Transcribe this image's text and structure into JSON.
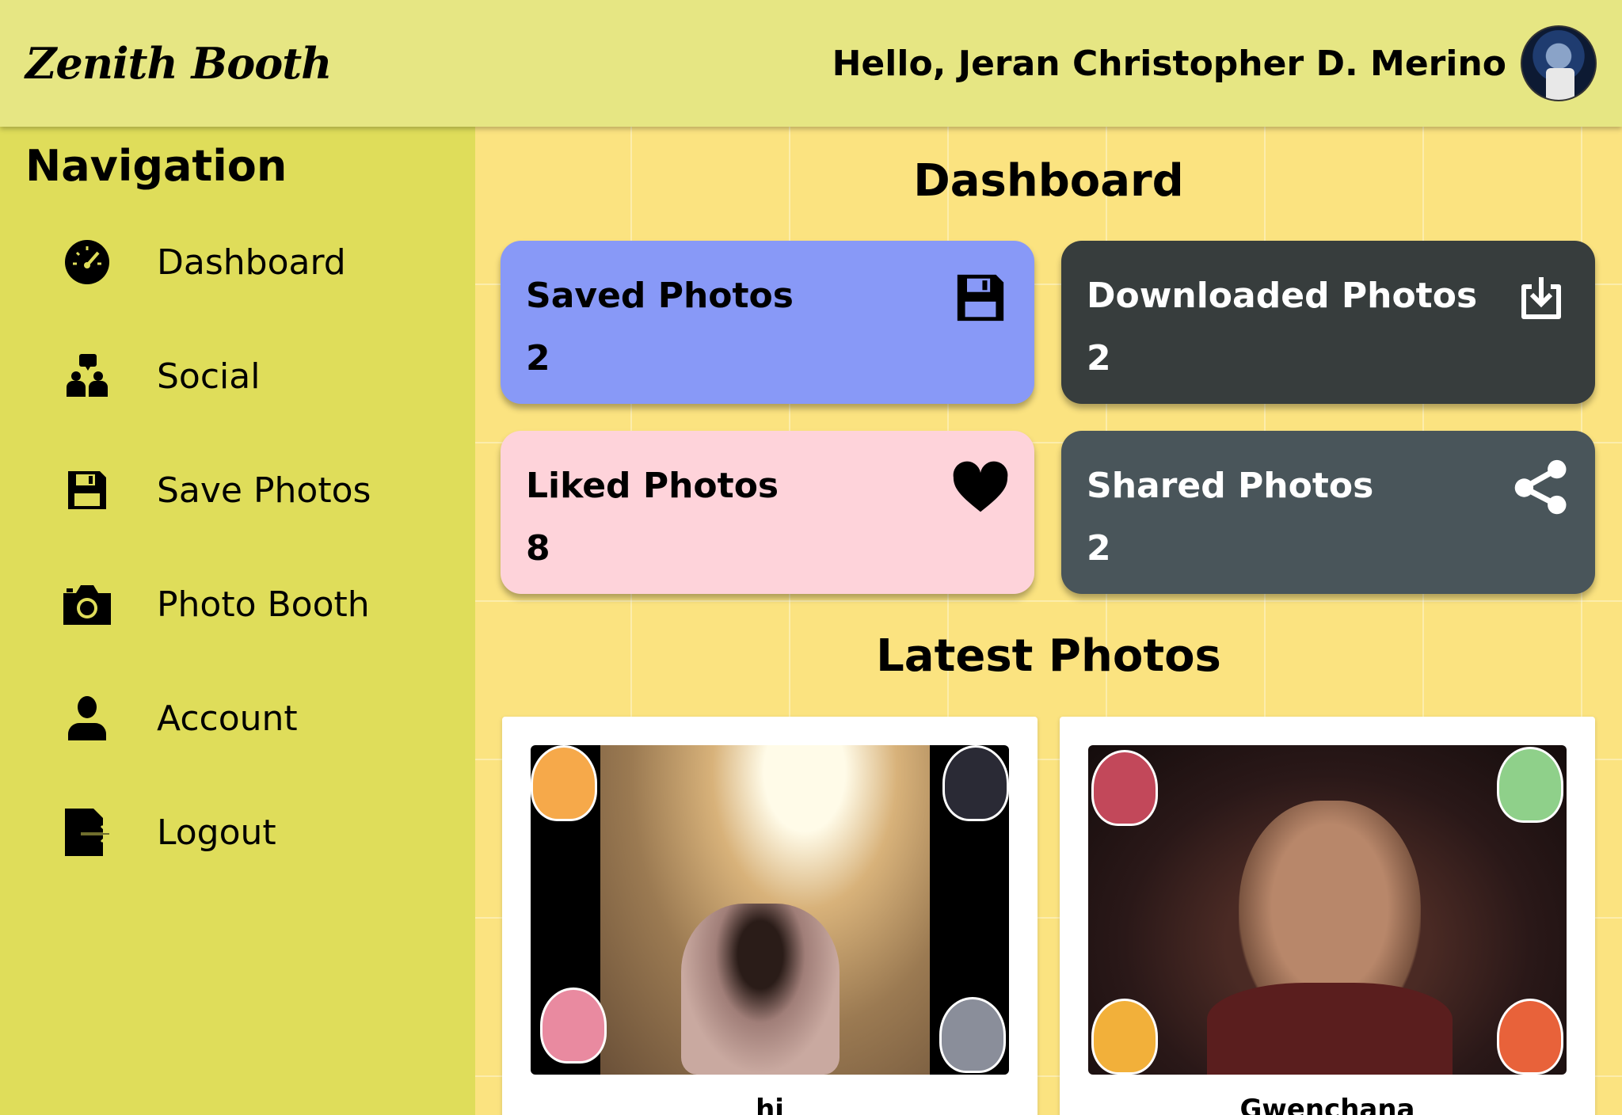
{
  "header": {
    "brand": "Zenith Booth",
    "greeting": "Hello, Jeran Christopher D. Merino"
  },
  "sidebar": {
    "title": "Navigation",
    "items": [
      {
        "label": "Dashboard",
        "icon": "speedometer-icon"
      },
      {
        "label": "Social",
        "icon": "people-chat-icon"
      },
      {
        "label": "Save Photos",
        "icon": "floppy-disk-icon"
      },
      {
        "label": "Photo Booth",
        "icon": "camera-icon"
      },
      {
        "label": "Account",
        "icon": "person-icon"
      },
      {
        "label": "Logout",
        "icon": "logout-icon"
      }
    ]
  },
  "main": {
    "title": "Dashboard",
    "stats": [
      {
        "title": "Saved Photos",
        "value": "2",
        "icon": "floppy-disk-icon",
        "bg": "#8899f7",
        "fg": "#000000"
      },
      {
        "title": "Downloaded Photos",
        "value": "2",
        "icon": "download-icon",
        "bg": "#373d3d",
        "fg": "#ffffff"
      },
      {
        "title": "Liked Photos",
        "value": "8",
        "icon": "heart-icon",
        "bg": "#fed3da",
        "fg": "#000000"
      },
      {
        "title": "Shared Photos",
        "value": "2",
        "icon": "share-icon",
        "bg": "#49555a",
        "fg": "#ffffff"
      }
    ],
    "latest_title": "Latest Photos",
    "photos": [
      {
        "caption": "hi"
      },
      {
        "caption": "Gwenchana"
      }
    ]
  },
  "colors": {
    "topbar": "#e6e683",
    "sidebar": "#dfdd5a",
    "background": "#fbe380"
  }
}
